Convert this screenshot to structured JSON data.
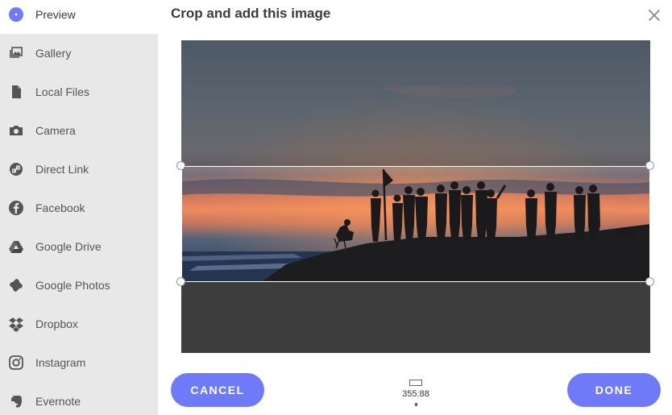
{
  "sidebar": {
    "items": [
      {
        "label": "Preview",
        "icon": "preview-icon",
        "active": true
      },
      {
        "label": "Gallery",
        "icon": "gallery-icon"
      },
      {
        "label": "Local Files",
        "icon": "file-icon"
      },
      {
        "label": "Camera",
        "icon": "camera-icon"
      },
      {
        "label": "Direct Link",
        "icon": "link-icon"
      },
      {
        "label": "Facebook",
        "icon": "facebook-icon"
      },
      {
        "label": "Google Drive",
        "icon": "google-drive-icon"
      },
      {
        "label": "Google Photos",
        "icon": "google-photos-icon"
      },
      {
        "label": "Dropbox",
        "icon": "dropbox-icon"
      },
      {
        "label": "Instagram",
        "icon": "instagram-icon"
      },
      {
        "label": "Evernote",
        "icon": "evernote-icon"
      }
    ]
  },
  "header": {
    "title": "Crop and add this image",
    "close_icon": "close-icon"
  },
  "footer": {
    "cancel_label": "CANCEL",
    "done_label": "DONE",
    "aspect_ratio": "355:88"
  },
  "colors": {
    "accent": "#6e7af7",
    "sidebar_bg": "#e8e8e8",
    "active_indicator": "#2f6bff"
  }
}
